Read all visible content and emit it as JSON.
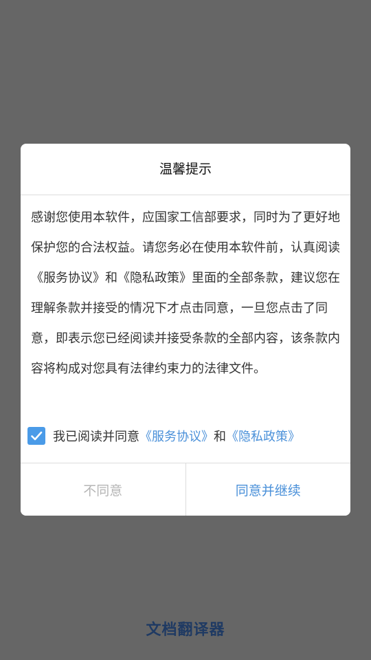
{
  "dialog": {
    "title": "温馨提示",
    "body": "感谢您使用本软件，应国家工信部要求，同时为了更好地保护您的合法权益。请您务必在使用本软件前，认真阅读《服务协议》和《隐私政策》里面的全部条款，建议您在理解条款并接受的情况下才点击同意，一旦您点击了同意，即表示您已经阅读并接受条款的全部内容，该条款内容将构成对您具有法律约束力的法律文件。",
    "agreement": {
      "checked": true,
      "prefix": "我已阅读并同意",
      "service_link": "《服务协议》",
      "conjunction": "和",
      "privacy_link": "《隐私政策》"
    },
    "disagree_label": "不同意",
    "agree_label": "同意并继续"
  },
  "app_name": "文档翻译器",
  "colors": {
    "overlay": "#666666",
    "link": "#4a90d9",
    "checkbox": "#4a9be8",
    "disabled_text": "#b5b5b5",
    "app_name": "#1f3a63"
  },
  "icons": {
    "checkbox": "checkmark-icon"
  }
}
